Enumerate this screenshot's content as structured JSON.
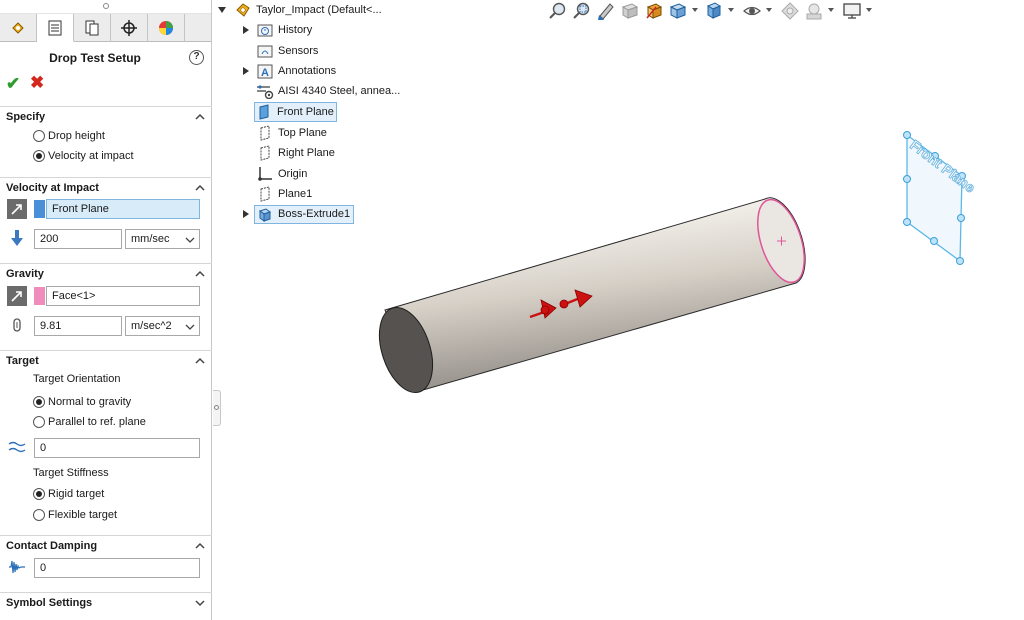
{
  "panel": {
    "title": "Drop Test Setup",
    "help_glyph": "?",
    "ok_glyph": "✔",
    "cancel_glyph": "✖",
    "tabs": [
      {
        "icon": "feature-manager-icon",
        "active": false
      },
      {
        "icon": "property-manager-icon",
        "active": true
      },
      {
        "icon": "configuration-manager-icon",
        "active": false
      },
      {
        "icon": "dimxpert-manager-icon",
        "active": false
      },
      {
        "icon": "display-manager-icon",
        "active": false
      }
    ],
    "specify": {
      "label": "Specify",
      "options": [
        {
          "label": "Drop height",
          "selected": false
        },
        {
          "label": "Velocity at impact",
          "selected": true
        }
      ]
    },
    "velocity": {
      "label": "Velocity at Impact",
      "reference": "Front Plane",
      "reference_color": "#4a90d9",
      "value": "200",
      "unit": "mm/sec"
    },
    "gravity": {
      "label": "Gravity",
      "reference": "Face<1>",
      "reference_color": "#f08cbc",
      "value": "9.81",
      "unit": "m/sec^2"
    },
    "target": {
      "label": "Target",
      "orientation_label": "Target Orientation",
      "orientation_options": [
        {
          "label": "Normal to gravity",
          "selected": true
        },
        {
          "label": "Parallel to ref. plane",
          "selected": false
        }
      ],
      "offset_value": "0",
      "stiffness_label": "Target Stiffness",
      "stiffness_options": [
        {
          "label": "Rigid target",
          "selected": true
        },
        {
          "label": "Flexible target",
          "selected": false
        }
      ]
    },
    "damping": {
      "label": "Contact Damping",
      "value": "0"
    },
    "symbol": {
      "label": "Symbol Settings"
    }
  },
  "tree": {
    "root": "Taylor_Impact  (Default<...",
    "items": [
      {
        "label": "History",
        "icon": "history-folder-icon",
        "expandable": true,
        "highlighted": false
      },
      {
        "label": "Sensors",
        "icon": "sensors-folder-icon",
        "expandable": false,
        "highlighted": false
      },
      {
        "label": "Annotations",
        "icon": "annotations-icon",
        "expandable": true,
        "highlighted": false
      },
      {
        "label": "AISI 4340 Steel, annea...",
        "icon": "material-icon",
        "expandable": false,
        "highlighted": false
      },
      {
        "label": "Front Plane",
        "icon": "plane-icon",
        "expandable": false,
        "highlighted": true
      },
      {
        "label": "Top Plane",
        "icon": "plane-icon",
        "expandable": false,
        "highlighted": false
      },
      {
        "label": "Right Plane",
        "icon": "plane-icon",
        "expandable": false,
        "highlighted": false
      },
      {
        "label": "Origin",
        "icon": "origin-icon",
        "expandable": false,
        "highlighted": false
      },
      {
        "label": "Plane1",
        "icon": "plane-icon",
        "expandable": false,
        "highlighted": false
      },
      {
        "label": "Boss-Extrude1",
        "icon": "extrude-feature-icon",
        "expandable": true,
        "highlighted": true
      }
    ]
  },
  "toolbar": {
    "icons": [
      "zoom-to-fit-icon",
      "zoom-to-area-icon",
      "previous-view-icon",
      "section-view-icon",
      "dynamic-annotation-icon",
      "view-orientation-icon",
      "display-style-icon",
      "hide-show-items-icon",
      "edit-appearance-icon",
      "apply-scene-icon",
      "view-settings-icon"
    ]
  },
  "graphics": {
    "plane_label": "Front Plane",
    "plane_color": "#5db8e8",
    "face_highlight_color": "#e0559a",
    "arrow_color": "#cc1111"
  }
}
